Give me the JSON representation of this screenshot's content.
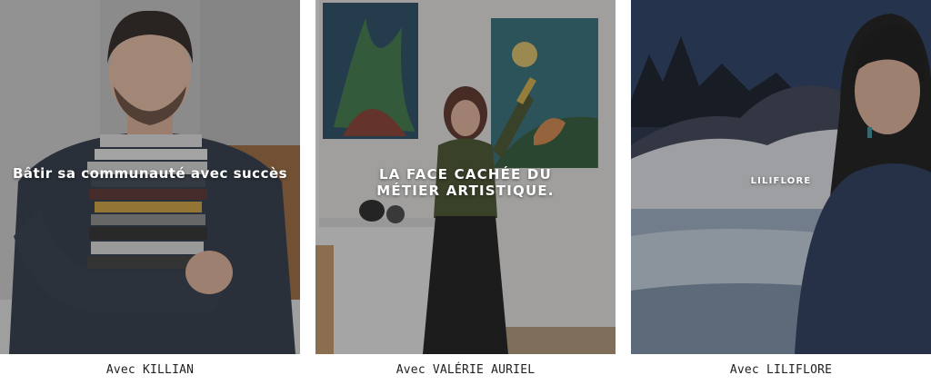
{
  "cards": [
    {
      "title": "Bâtir sa communauté avec succès",
      "caption": "Avec KILLIAN",
      "image": "man-holding-books-photo"
    },
    {
      "title": "LA FACE CACHÉE DU MÉTIER ARTISTIQUE.",
      "caption": "Avec VALÉRIE AURIEL",
      "image": "artist-with-paintings-photo"
    },
    {
      "title": "LILIFLORE",
      "caption": "Avec LILIFLORE",
      "image": "woman-with-landscape-painting-photo"
    }
  ],
  "colors": {
    "overlay": "#282828",
    "caption_text": "#222222",
    "title_text": "#ffffff"
  }
}
